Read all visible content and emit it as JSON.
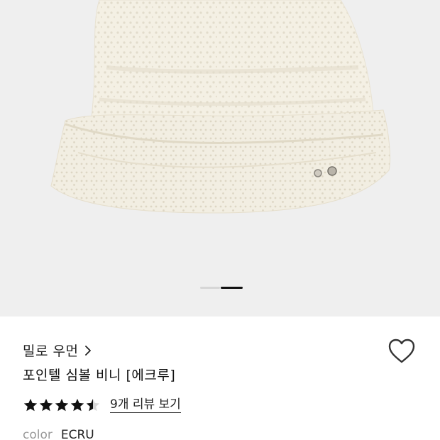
{
  "product": {
    "brand": "밀로 우먼",
    "title": "포인텔 심볼 비니 [에크루]",
    "rating": 4.5,
    "review_link": "9개 리뷰 보기",
    "color_label": "color",
    "color_value": "ECRU"
  },
  "gallery": {
    "total_images": 2,
    "active_index": 1
  },
  "colors": {
    "image_bg": "#efefef",
    "beanie": "#f3efe3",
    "text": "#111111",
    "muted": "#999999"
  },
  "icons": {
    "brand_chevron": "chevron-right-icon",
    "wishlist": "heart-outline-icon",
    "star": "star-icon"
  }
}
